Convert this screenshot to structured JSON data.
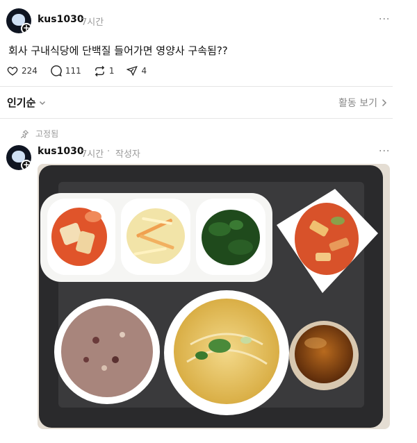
{
  "post": {
    "username": "kus1030",
    "time": "7시간",
    "text": "회사 구내식당에 단백질 들어가면 영양사 구속됨??",
    "more_icon": "more-horizontal-icon"
  },
  "actions": {
    "likes": "224",
    "comments": "111",
    "reposts": "1",
    "shares": "4"
  },
  "sort": {
    "label": "인기순",
    "activity_label": "활동 보기"
  },
  "pinned": {
    "label": "고정됨"
  },
  "reply": {
    "username": "kus1030",
    "time": "7시간",
    "separator": "·",
    "author_label": "작성자"
  },
  "colors": {
    "tray": "#2a2a2c",
    "divider": "#e5e5e5",
    "muted_text": "#999999"
  }
}
